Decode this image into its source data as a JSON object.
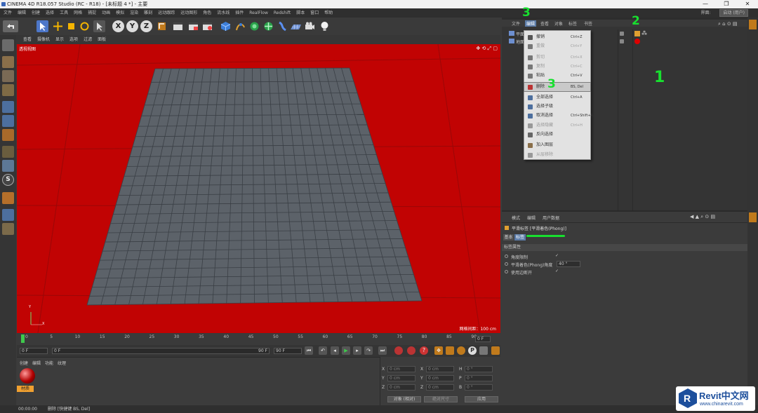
{
  "window": {
    "title": "CINEMA 4D R18.057 Studio (RC - R18) - [未标题 4 *] - 主要",
    "min": "—",
    "max": "❐",
    "close": "✕"
  },
  "menubar": {
    "items": [
      "文件",
      "编辑",
      "创建",
      "选择",
      "工具",
      "网格",
      "捕捉",
      "动画",
      "模拟",
      "渲染",
      "雕刻",
      "运动跟踪",
      "运动图形",
      "角色",
      "流水线",
      "插件",
      "RealFlow",
      "Redshift",
      "脚本",
      "窗口",
      "帮助"
    ],
    "layout_label": "界面:",
    "layout_value": "启动 (用户)"
  },
  "toolbar": {
    "xyz": [
      "X",
      "Y",
      "Z"
    ]
  },
  "viewport": {
    "menu": [
      "查看",
      "摄像机",
      "显示",
      "选项",
      "过滤",
      "面板"
    ],
    "label": "透视视图",
    "grid_spacing": "网格间距：100 cm",
    "axis_y": "Y",
    "axis_x": "X"
  },
  "timeline": {
    "ticks": [
      "0",
      "5",
      "10",
      "15",
      "20",
      "25",
      "30",
      "35",
      "40",
      "45",
      "50",
      "55",
      "60",
      "65",
      "70",
      "75",
      "80",
      "85",
      "90"
    ],
    "current_frame": "0 F"
  },
  "transport": {
    "start": "0 F",
    "range_start": "0 F",
    "range_end": "90 F",
    "end": "90 F"
  },
  "material_manager": {
    "menu": [
      "创建",
      "编辑",
      "功能",
      "纹理"
    ],
    "material_name": "材质"
  },
  "coordinates": {
    "rows": [
      {
        "pos_label": "X",
        "pos": "0 cm",
        "size_label": "X",
        "size": "0 cm",
        "rot_label": "H",
        "rot": "0 °"
      },
      {
        "pos_label": "Y",
        "pos": "0 cm",
        "size_label": "Y",
        "size": "0 cm",
        "rot_label": "P",
        "rot": "0 °"
      },
      {
        "pos_label": "Z",
        "pos": "0 cm",
        "size_label": "Z",
        "size": "0 cm",
        "rot_label": "B",
        "rot": "0 °"
      }
    ],
    "mode": "对象 (相对)",
    "size_mode": "绝对尺寸",
    "apply": "应用"
  },
  "object_manager": {
    "menu": [
      "文件",
      "编辑",
      "查看",
      "对象",
      "标签",
      "书签"
    ],
    "objects": [
      "平面",
      "地面"
    ]
  },
  "context_menu": {
    "items": [
      {
        "label": "撤销",
        "shortcut": "Ctrl+Z",
        "disabled": false
      },
      {
        "label": "重做",
        "shortcut": "Ctrl+Y",
        "disabled": true
      },
      {
        "label": "剪切",
        "shortcut": "Ctrl+X",
        "disabled": true
      },
      {
        "label": "复制",
        "shortcut": "Ctrl+C",
        "disabled": true
      },
      {
        "label": "粘贴",
        "shortcut": "Ctrl+V",
        "disabled": false
      },
      {
        "label": "删除",
        "shortcut": "BS, Del",
        "disabled": false,
        "highlight": true
      },
      {
        "label": "全部选择",
        "shortcut": "Ctrl+A",
        "disabled": false
      },
      {
        "label": "选择子级",
        "shortcut": "",
        "disabled": false
      },
      {
        "label": "取消选择",
        "shortcut": "Ctrl+Shift+A",
        "disabled": false
      },
      {
        "label": "选择隐藏",
        "shortcut": "Ctrl+H",
        "disabled": true
      },
      {
        "label": "反向选择",
        "shortcut": "",
        "disabled": false
      },
      {
        "label": "加入图层",
        "shortcut": "",
        "disabled": false
      },
      {
        "label": "从层移除",
        "shortcut": "",
        "disabled": true
      }
    ]
  },
  "attribute_manager": {
    "menu": [
      "模式",
      "编辑",
      "用户数据"
    ],
    "title": "平滑标签 [平滑着色(Phong)]",
    "tabs": [
      "基本",
      "标签"
    ],
    "section": "标签属性",
    "props": [
      {
        "label": "角度限制",
        "value": "✓"
      },
      {
        "label": "平滑着色(Phong)角度",
        "value": "40 °"
      },
      {
        "label": "使用边断开",
        "value": "✓"
      }
    ]
  },
  "statusbar": {
    "time": "00:00:00",
    "message": "删除 [快捷键 BS, Del]"
  },
  "annotations": [
    "3",
    "2",
    "3",
    "1"
  ],
  "watermark": {
    "brand": "Revit中文网",
    "url": "www.chinarevit.com"
  },
  "colors": {
    "viewport_bg": "#c10303",
    "plane": "#5c6269",
    "annotation": "#18e02f"
  }
}
